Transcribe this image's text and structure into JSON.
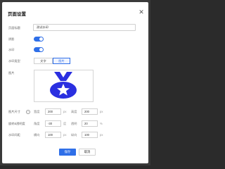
{
  "dialog": {
    "title": "页面设置",
    "close_icon": "close-icon"
  },
  "fields": {
    "page_title_label": "页面标题",
    "page_title_value": "测试水印",
    "border_label": "阴影",
    "border_on": true,
    "watermark_label": "水印",
    "watermark_on": true,
    "watermark_type_label": "水印类型",
    "type_options": [
      "文字",
      "图片"
    ],
    "type_selected": "图片",
    "image_label": "图片"
  },
  "size": {
    "label": "图片尺寸",
    "width_label": "宽度",
    "width_value": "200",
    "width_unit": "px",
    "height_label": "高度",
    "height_value": "200",
    "height_unit": "px"
  },
  "rotate": {
    "label": "旋转&透明度",
    "angle_label": "角度",
    "angle_value": "-30",
    "angle_unit": "度",
    "opacity_label": "透明",
    "opacity_value": "20",
    "opacity_unit": "%"
  },
  "spacing": {
    "label": "水印间距",
    "h_label": "横向",
    "h_value": "100",
    "h_unit": "px",
    "v_label": "纵向",
    "v_value": "100",
    "v_unit": "px"
  },
  "buttons": {
    "save": "保存",
    "cancel": "取消"
  },
  "colors": {
    "accent": "#2f6fe8",
    "medal": "#2a2fe0"
  }
}
